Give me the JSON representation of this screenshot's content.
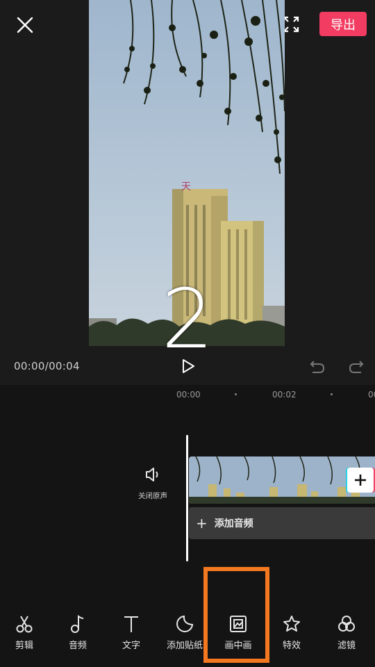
{
  "header": {
    "export_label": "导出"
  },
  "preview": {
    "overlay_number": "2",
    "building_sign": "天"
  },
  "playback": {
    "time_readout": "00:00/00:04"
  },
  "timeline": {
    "ruler": [
      "00:00",
      "00:02",
      "00"
    ],
    "mute_label": "关闭原声",
    "add_audio_label": "添加音频"
  },
  "toolbar": {
    "items": [
      {
        "label": "剪辑",
        "icon": "scissors-icon"
      },
      {
        "label": "音频",
        "icon": "music-note-icon"
      },
      {
        "label": "文字",
        "icon": "text-icon"
      },
      {
        "label": "添加贴纸",
        "icon": "sticker-icon"
      },
      {
        "label": "画中画",
        "icon": "picture-in-picture-icon"
      },
      {
        "label": "特效",
        "icon": "star-effect-icon"
      },
      {
        "label": "滤镜",
        "icon": "filter-icon"
      }
    ]
  },
  "colors": {
    "accent": "#f23c62",
    "highlight": "#f3781f",
    "background": "#1b1b1b"
  }
}
